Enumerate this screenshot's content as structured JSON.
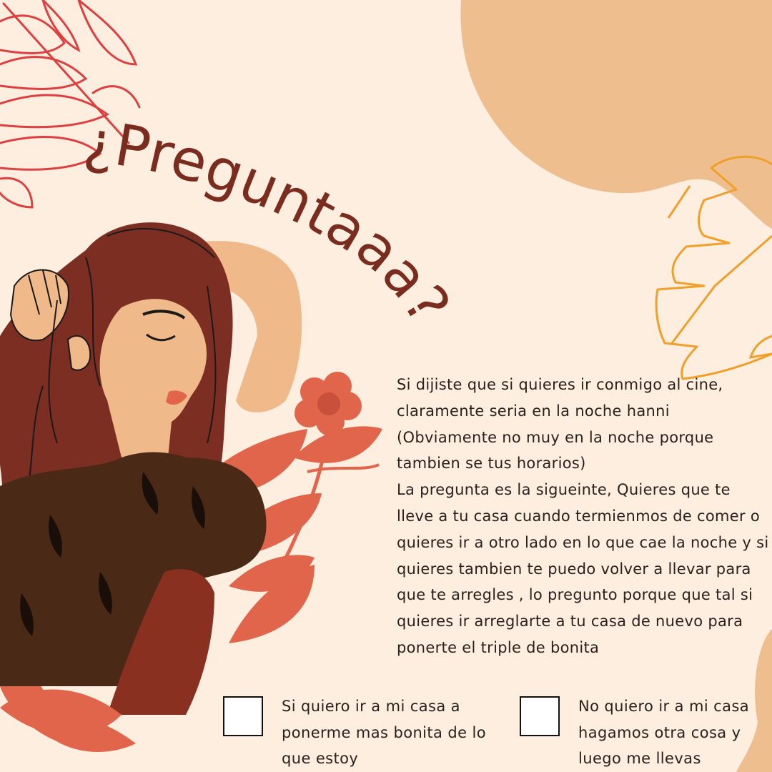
{
  "title": "¿Preguntaaa?",
  "message": {
    "paragraph_1": "Si dijiste que si quieres ir conmigo al cine, claramente seria en la noche hanni (Obviamente no muy en la noche porque tambien se tus horarios)",
    "paragraph_2": "La pregunta es la sigueinte, Quieres que te lleve a tu casa cuando termienmos de comer o quieres ir a otro lado en lo que cae la noche y si quieres tambien te puedo volver a llevar para que te arregles , lo pregunto porque que tal si quieres ir arreglarte a tu casa de nuevo para ponerte el triple de bonita"
  },
  "options": [
    {
      "label": "Si quiero ir a mi casa a ponerme mas bonita de lo que estoy",
      "checked": false
    },
    {
      "label": "No quiero ir a mi casa hagamos otra cosa y luego me llevas",
      "checked": false
    }
  ],
  "colors": {
    "background": "#fdeee0",
    "title": "#7a2c1e",
    "peach_blob": "#efbe8e",
    "red_leaf_outline": "#dd4040",
    "orange_leaf_outline": "#f0a02a",
    "coral": "#e0654a",
    "hair": "#7c2e22",
    "skin": "#f0b98a",
    "shirt": "#4a2a16"
  },
  "illustration": {
    "subject": "woman-with-closed-eyes-hand-in-hair",
    "decor": [
      "red-leaf-outline",
      "orange-leaf-outline",
      "peach-blob",
      "coral-flower",
      "coral-leaves"
    ]
  }
}
